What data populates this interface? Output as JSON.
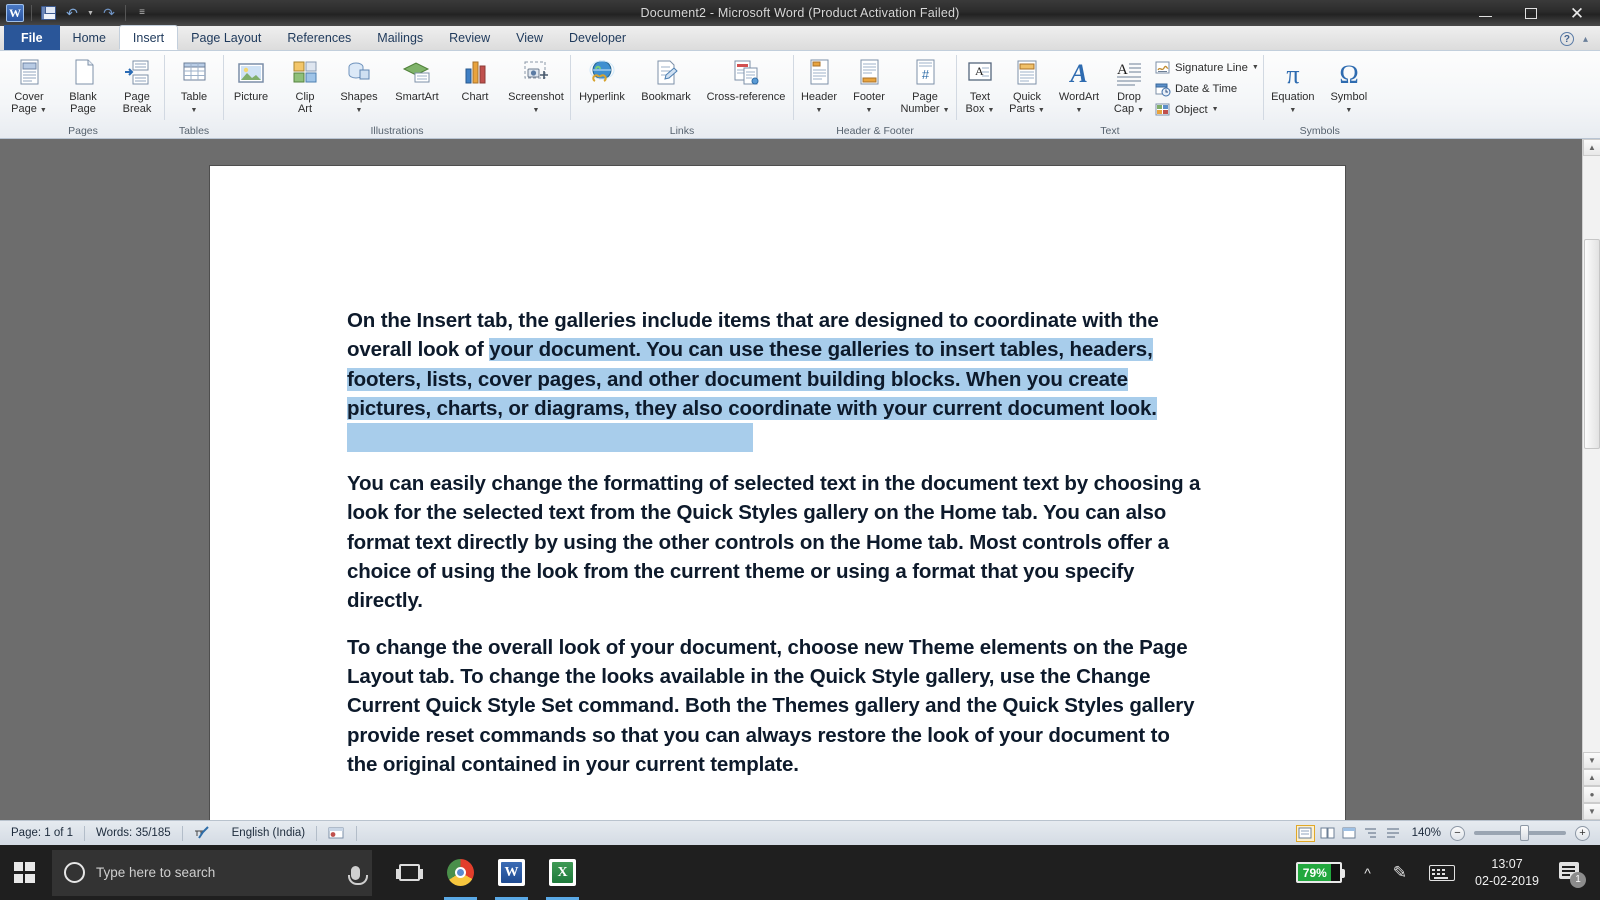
{
  "titlebar": {
    "title": "Document2  -  Microsoft Word (Product Activation Failed)",
    "quick_access": [
      {
        "name": "word-app-icon",
        "label": "W"
      },
      {
        "name": "save-icon",
        "label": "Save"
      },
      {
        "name": "undo-icon",
        "label": "Undo"
      },
      {
        "name": "redo-icon",
        "label": "Redo"
      },
      {
        "name": "customize-qat-icon",
        "label": "Customize Quick Access Toolbar"
      }
    ],
    "window_controls": [
      {
        "name": "minimize-button",
        "label": "Minimize"
      },
      {
        "name": "maximize-button",
        "label": "Maximize"
      },
      {
        "name": "close-button",
        "label": "Close"
      }
    ]
  },
  "tabs": [
    {
      "label": "File",
      "active": false,
      "file": true
    },
    {
      "label": "Home",
      "active": false
    },
    {
      "label": "Insert",
      "active": true
    },
    {
      "label": "Page Layout",
      "active": false
    },
    {
      "label": "References",
      "active": false
    },
    {
      "label": "Mailings",
      "active": false
    },
    {
      "label": "Review",
      "active": false
    },
    {
      "label": "View",
      "active": false
    },
    {
      "label": "Developer",
      "active": false
    }
  ],
  "tabstrip_right": {
    "help_label": "?",
    "minimize_ribbon_label": "▴"
  },
  "ribbon": {
    "groups": [
      {
        "name": "pages",
        "label": "Pages",
        "buttons": [
          {
            "name": "cover-page-button",
            "line1": "Cover",
            "line2": "Page",
            "dropdown": true
          },
          {
            "name": "blank-page-button",
            "line1": "Blank",
            "line2": "Page",
            "dropdown": false
          },
          {
            "name": "page-break-button",
            "line1": "Page",
            "line2": "Break",
            "dropdown": false
          }
        ]
      },
      {
        "name": "tables",
        "label": "Tables",
        "buttons": [
          {
            "name": "table-button",
            "line1": "Table",
            "line2": "",
            "dropdown": true
          }
        ]
      },
      {
        "name": "illustrations",
        "label": "Illustrations",
        "buttons": [
          {
            "name": "picture-button",
            "line1": "Picture",
            "line2": "",
            "dropdown": false
          },
          {
            "name": "clip-art-button",
            "line1": "Clip",
            "line2": "Art",
            "dropdown": false
          },
          {
            "name": "shapes-button",
            "line1": "Shapes",
            "line2": "",
            "dropdown": true
          },
          {
            "name": "smartart-button",
            "line1": "SmartArt",
            "line2": "",
            "dropdown": false
          },
          {
            "name": "chart-button",
            "line1": "Chart",
            "line2": "",
            "dropdown": false
          },
          {
            "name": "screenshot-button",
            "line1": "Screenshot",
            "line2": "",
            "dropdown": true
          }
        ]
      },
      {
        "name": "links",
        "label": "Links",
        "buttons": [
          {
            "name": "hyperlink-button",
            "line1": "Hyperlink",
            "line2": "",
            "dropdown": false
          },
          {
            "name": "bookmark-button",
            "line1": "Bookmark",
            "line2": "",
            "dropdown": false
          },
          {
            "name": "cross-reference-button",
            "line1": "Cross-reference",
            "line2": "",
            "dropdown": false
          }
        ]
      },
      {
        "name": "header-footer",
        "label": "Header & Footer",
        "buttons": [
          {
            "name": "header-button",
            "line1": "Header",
            "line2": "",
            "dropdown": true
          },
          {
            "name": "footer-button",
            "line1": "Footer",
            "line2": "",
            "dropdown": true
          },
          {
            "name": "page-number-button",
            "line1": "Page",
            "line2": "Number",
            "dropdown": true
          }
        ]
      },
      {
        "name": "text",
        "label": "Text",
        "buttons": [
          {
            "name": "text-box-button",
            "line1": "Text",
            "line2": "Box",
            "dropdown": true
          },
          {
            "name": "quick-parts-button",
            "line1": "Quick",
            "line2": "Parts",
            "dropdown": true
          },
          {
            "name": "wordart-button",
            "line1": "WordArt",
            "line2": "",
            "dropdown": true
          },
          {
            "name": "drop-cap-button",
            "line1": "Drop",
            "line2": "Cap",
            "dropdown": true
          }
        ],
        "small_buttons": [
          {
            "name": "signature-line-button",
            "label": "Signature Line",
            "dropdown": true
          },
          {
            "name": "date-and-time-button",
            "label": "Date & Time",
            "dropdown": false
          },
          {
            "name": "object-button",
            "label": "Object",
            "dropdown": true
          }
        ]
      },
      {
        "name": "symbols",
        "label": "Symbols",
        "buttons": [
          {
            "name": "equation-button",
            "line1": "Equation",
            "line2": "",
            "glyph": "π",
            "dropdown": true
          },
          {
            "name": "symbol-button",
            "line1": "Symbol",
            "line2": "",
            "glyph": "Ω",
            "dropdown": true
          }
        ]
      }
    ]
  },
  "document": {
    "paragraphs": [
      {
        "name": "paragraph-1",
        "runs": [
          {
            "text": "On the Insert tab, the galleries include items that are designed to coordinate with the overall look of ",
            "selected": false
          },
          {
            "text": "your document. You can use these galleries to insert tables, headers, footers, lists, cover pages, and other document building blocks. When you create pictures, charts, or diagrams, they also coordinate with your current document look.",
            "selected": true
          }
        ]
      },
      {
        "name": "paragraph-2",
        "runs": [
          {
            "text": "You can easily change the formatting of selected text in the document text by choosing a look for the selected text from the Quick Styles gallery on the Home tab. You can also format text directly by using the other controls on the Home tab. Most controls offer a choice of using the look from the current theme or using a format that you specify directly.",
            "selected": false
          }
        ]
      },
      {
        "name": "paragraph-3",
        "runs": [
          {
            "text": "To change the overall look of your document, choose new Theme elements on the Page Layout tab. To change the looks available in the Quick Style gallery, use the Change Current Quick Style Set command. Both the Themes gallery and the Quick Styles gallery provide reset commands so that you can always restore the look of your document to the original contained in your current template.",
            "selected": false
          }
        ]
      }
    ]
  },
  "statusbar": {
    "page": "Page: 1 of 1",
    "words": "Words: 35/185",
    "language": "English (India)",
    "zoom_level": "140%",
    "view_buttons": [
      {
        "name": "print-layout-view-button",
        "active": true
      },
      {
        "name": "full-screen-reading-view-button",
        "active": false
      },
      {
        "name": "web-layout-view-button",
        "active": false
      },
      {
        "name": "outline-view-button",
        "active": false
      },
      {
        "name": "draft-view-button",
        "active": false
      }
    ],
    "zoom_out_label": "−",
    "zoom_in_label": "+"
  },
  "taskbar": {
    "search_placeholder": "Type here to search",
    "items": [
      {
        "name": "taskbar-chrome-icon",
        "label": "Google Chrome",
        "running": true
      },
      {
        "name": "taskbar-word-icon",
        "label": "Microsoft Word",
        "running": true,
        "letter": "W"
      },
      {
        "name": "taskbar-excel-icon",
        "label": "Microsoft Excel",
        "running": true,
        "letter": "X"
      }
    ],
    "tray": {
      "battery_percent": "79%",
      "time": "13:07",
      "date": "02-02-2019",
      "notification_count": "1"
    }
  },
  "colors": {
    "accent_blue": "#2a5699",
    "selection_blue": "#a8cdeb",
    "battery_green": "#22a83e",
    "desktop_gray": "#6d6d6d"
  }
}
